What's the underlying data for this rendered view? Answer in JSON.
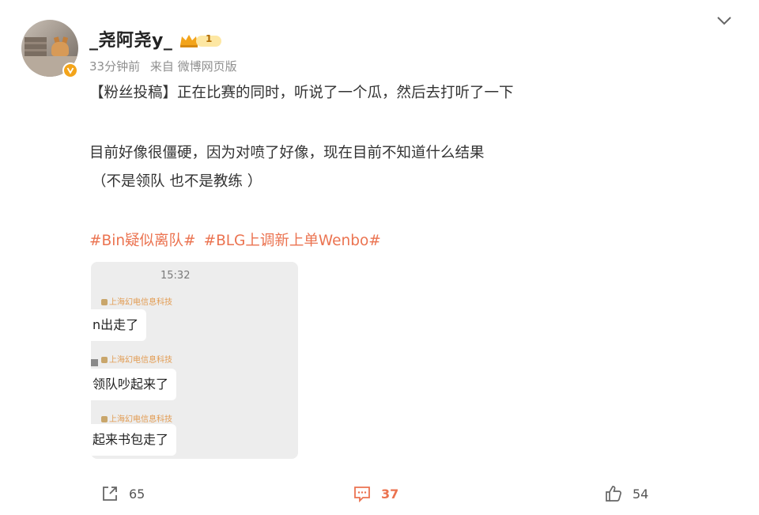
{
  "post": {
    "username": "_尧阿尧y_",
    "vip_level": "1",
    "time": "33分钟前",
    "source": "来自 微博网页版",
    "lines": [
      "【粉丝投稿】正在比赛的同时，听说了一个瓜，然后去打听了一下",
      "目前好像很僵硬，因为对喷了好像，现在目前不知道什么结果",
      "（不是领队 也不是教练 ）"
    ],
    "hashtags": [
      "#Bin疑似离队#",
      "#BLG上调新上单Wenbo#"
    ]
  },
  "chat": {
    "time": "15:32",
    "sender": "上海幻电信息科技",
    "messages": [
      "n出走了",
      "领队吵起来了",
      "起来书包走了"
    ]
  },
  "actions": {
    "share_count": "65",
    "comment_count": "37",
    "like_count": "54"
  },
  "colors": {
    "accent": "#eb7350",
    "vip": "#f3a41a"
  },
  "icons": [
    "chevron-down-icon",
    "verified-v-icon",
    "vip-crown-icon",
    "share-icon",
    "comment-icon",
    "like-icon"
  ]
}
